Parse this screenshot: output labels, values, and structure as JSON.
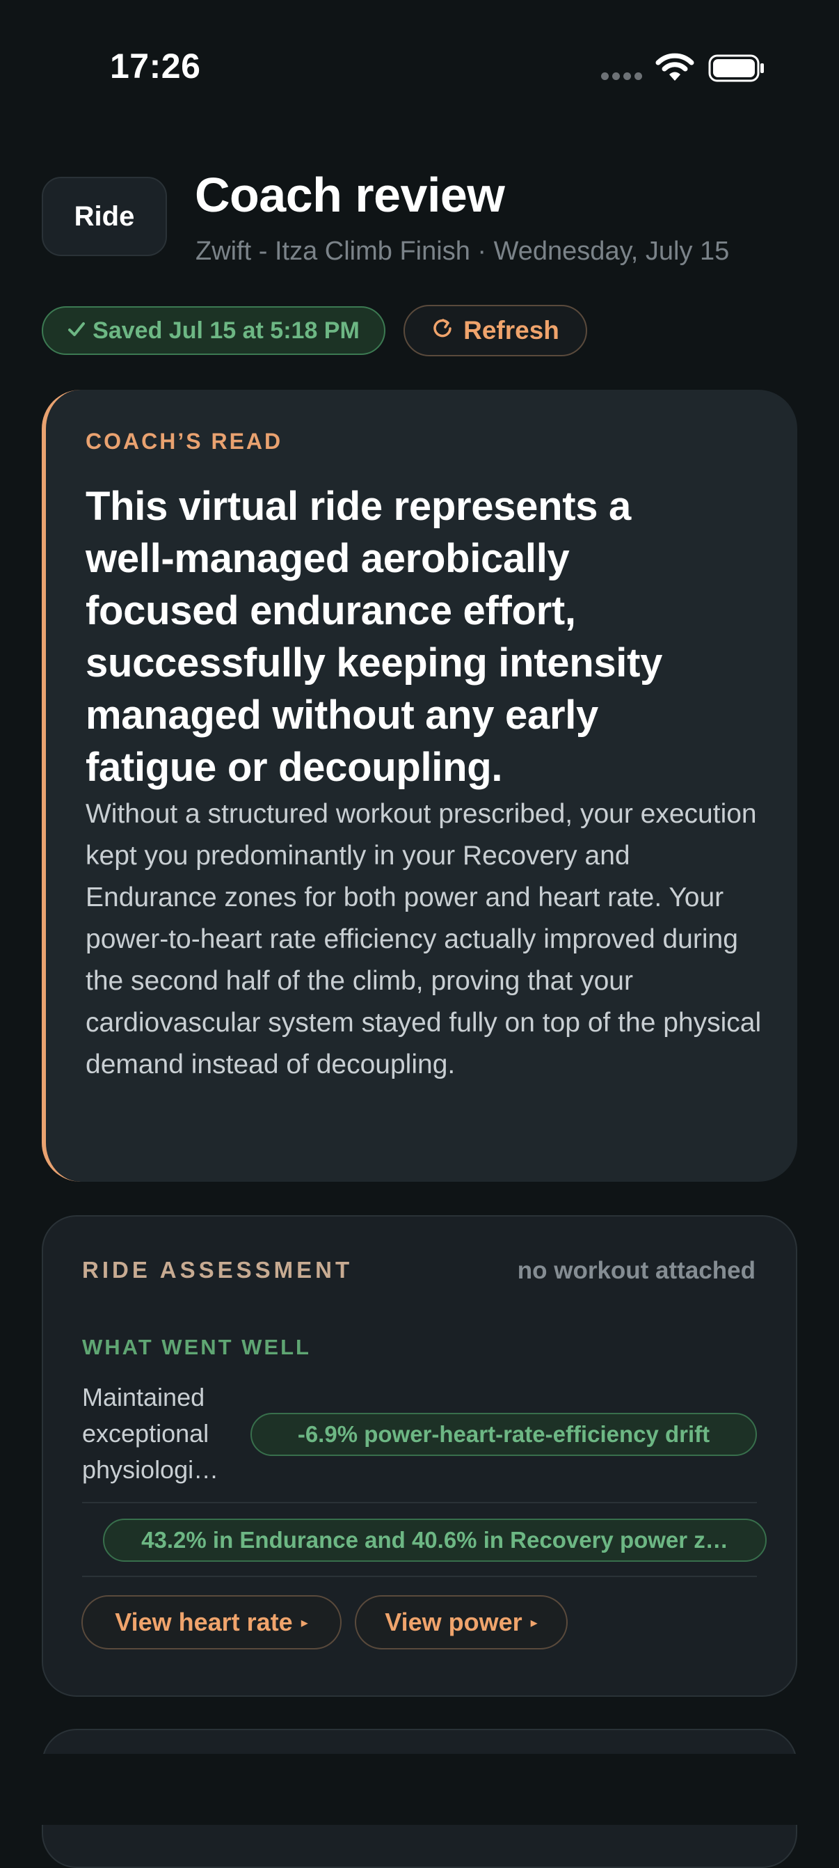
{
  "status_bar": {
    "time": "17:26",
    "icons": [
      "cellular-signal-icon",
      "wifi-icon",
      "battery-icon"
    ]
  },
  "header": {
    "chip": "Ride",
    "title": "Coach review",
    "subtitle": "Zwift - Itza Climb Finish · Wednesday, July 15"
  },
  "actions": {
    "saved": "Saved Jul 15 at 5:18 PM",
    "saved_icon": "checkmark-icon",
    "refresh": "Refresh",
    "refresh_icon": "refresh-icon"
  },
  "coach": {
    "label": "COACH’S READ",
    "headline": "This virtual ride represents a well-managed aerobically focused endurance effort, successfully keeping intensity managed without any early fatigue or decoupling.",
    "body": "Without a structured workout prescribed, your execution kept you predominantly in your Recovery and Endurance zones for both power and heart rate. Your power-to-heart rate efficiency actually improved during the second half of the climb, proving that your cardiovascular system stayed fully on top of the physical demand instead of decoupling."
  },
  "assessment": {
    "label": "RIDE ASSESSMENT",
    "note": "no workout attached",
    "well_label": "WHAT WENT WELL",
    "well_text": "Maintained exceptional physiologi…",
    "metric_1": "-6.9% power-heart-rate-efficiency drift",
    "metric_2": "43.2% in Endurance and 40.6% in Recovery power z…",
    "view_heart_rate": "View heart rate",
    "view_power": "View power"
  },
  "colors": {
    "background": "#0f1416",
    "card": "#1f272c",
    "accent": "#e9a270",
    "success": "#6db784"
  }
}
